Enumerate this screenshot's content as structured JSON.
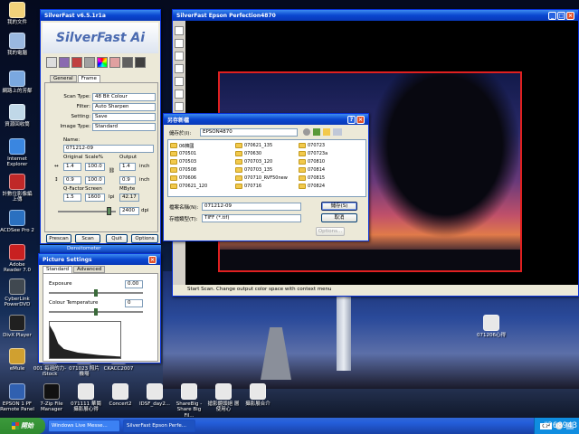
{
  "desktop_icons": [
    {
      "label": "我的文件"
    },
    {
      "label": "我的電腦"
    },
    {
      "label": "網路上的芳鄰"
    },
    {
      "label": "資源回收筒"
    },
    {
      "label": "Internet Explorer"
    },
    {
      "label": "計數位影像編上傳"
    },
    {
      "label": "ACDSee Pro 2"
    },
    {
      "label": "Adobe Reader 7.0"
    },
    {
      "label": "CyberLink PowerDVD"
    },
    {
      "label": "DivX Player"
    },
    {
      "label": "eMule"
    },
    {
      "label": "001 每週的力-iStock"
    },
    {
      "label": "071023 照片 機場"
    },
    {
      "label": "CKACC2007"
    },
    {
      "label": "EPSON 1 PF Remote Panel"
    },
    {
      "label": "7-Zip File Manager"
    },
    {
      "label": "071111 華崗 攝影展心得"
    },
    {
      "label": "Concert2"
    },
    {
      "label": "IDSF_day2..."
    },
    {
      "label": "ShareBig - Share Big Fil..."
    },
    {
      "label": "搶影鏡頭絕 層使用心"
    },
    {
      "label": "攝影展合介"
    },
    {
      "label": "071206心得"
    }
  ],
  "silverfast": {
    "title": "SilverFast v6.5.1r1a",
    "brand": "SilverFast Ai",
    "tabs": [
      "General",
      "Frame"
    ],
    "scan_type_label": "Scan Type:",
    "scan_type": "48 Bit Colour",
    "filter_label": "Filter:",
    "filter": "Auto Sharpen",
    "setting_label": "Setting:",
    "setting": "Save",
    "image_type_label": "Image Type:",
    "image_type": "Standard",
    "name_label": "Name:",
    "name": "071212-09",
    "original_label": "Original",
    "scale_label": "Scale%",
    "output_label": "Output",
    "w_orig": "1.4",
    "w_scale": "100.0",
    "w_out": "1.4",
    "w_unit": "inch",
    "h_orig": "0.9",
    "h_scale": "100.0",
    "h_out": "0.9",
    "h_unit": "inch",
    "qfactor_label": "Q-Factor",
    "screen_label": "Screen",
    "mbyte_label": "MByte",
    "qfactor": "1.5",
    "screen": "1600",
    "screen_unit": "lpi",
    "mbyte": "42.17",
    "dpi_value": "2400",
    "dpi_unit": "dpi",
    "buttons": [
      "Prescan",
      "Scan",
      "Quit",
      "Options"
    ]
  },
  "scanwin": {
    "title": "SilverFast Epson Perfection4870",
    "status": "Start Scan. Change output color space with context menu"
  },
  "saveas": {
    "title": "另存新檔",
    "savein_label": "儲存於(I):",
    "savein": "EPSON4870",
    "folders": [
      "06韓國",
      "070501",
      "070503",
      "070508",
      "070606",
      "070621_120",
      "070621_135",
      "070630",
      "070703_120",
      "070703_135",
      "070710_RVF50new",
      "070716",
      "070723",
      "070723a",
      "070810",
      "070814",
      "070815",
      "070824"
    ],
    "filename_label": "檔案名稱(N):",
    "filename": "071212-09",
    "filetype_label": "存檔類型(T):",
    "filetype": "TIFF (*.tif)",
    "save_btn": "儲存(S)",
    "cancel_btn": "取消",
    "options_btn": "Options..."
  },
  "picture_settings": {
    "title": "Picture Settings",
    "tabs": [
      "Standard",
      "Advanced"
    ],
    "exposure_label": "Exposure",
    "exposure": "0.00",
    "colortemp_label": "Colour Temperature",
    "colortemp": "0"
  },
  "densitometer": {
    "title": "Densitometer"
  },
  "taskbar": {
    "start": "開始",
    "tasks": [
      "Windows Live Messe...",
      "SilverFast Epson Perfe..."
    ],
    "tray_lang": "CH",
    "watermark": "#268943"
  }
}
